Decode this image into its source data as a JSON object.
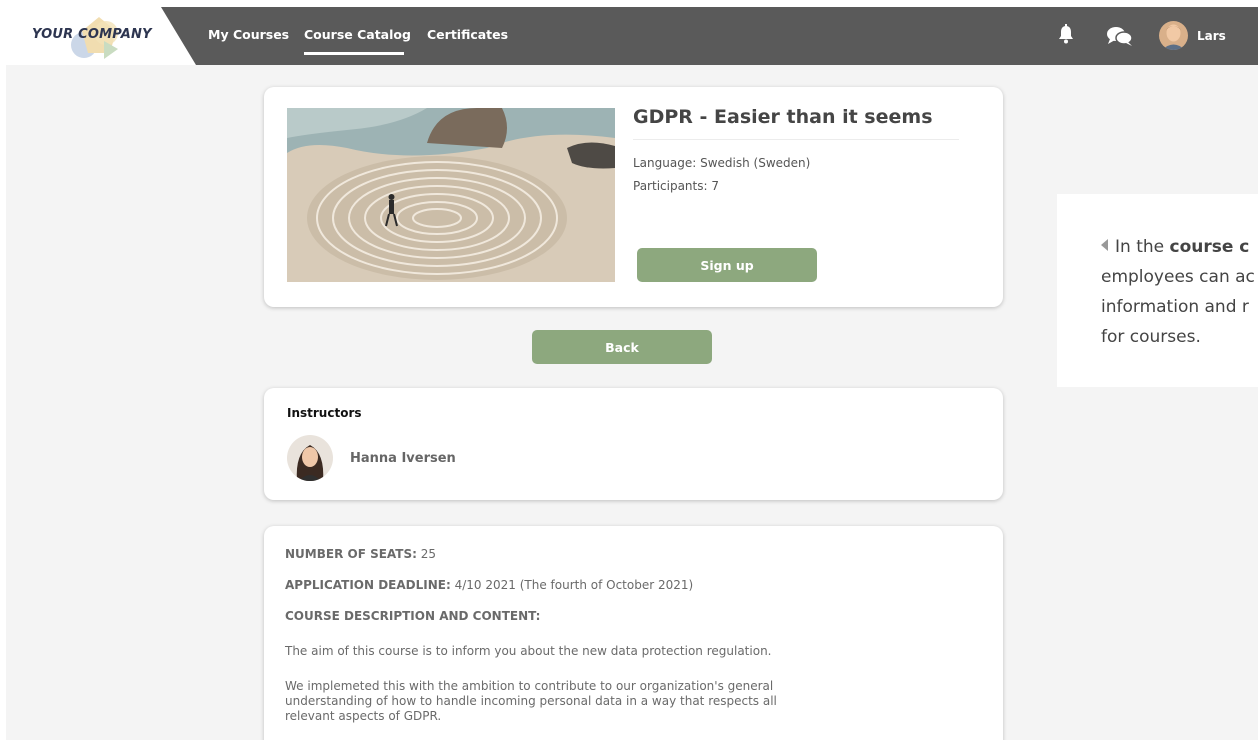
{
  "brand": {
    "logo_text": "YOUR COMPANY"
  },
  "nav": {
    "items": [
      {
        "label": "My Courses"
      },
      {
        "label": "Course Catalog"
      },
      {
        "label": "Certificates"
      }
    ],
    "user_name": "Lars",
    "icons": [
      "bell-icon",
      "chat-icon"
    ]
  },
  "course": {
    "title": "GDPR - Easier than it seems",
    "language": "Language: Swedish (Sweden)",
    "participants": "Participants: 7",
    "signup_label": "Sign up"
  },
  "back_label": "Back",
  "instructors": {
    "heading": "Instructors",
    "list": [
      {
        "name": "Hanna Iversen"
      }
    ]
  },
  "details": {
    "seats_label": "NUMBER OF SEATS:",
    "seats_value": " 25",
    "deadline_label": "APPLICATION DEADLINE:",
    "deadline_value": " 4/10 2021 (The fourth of October 2021)",
    "description_heading": "COURSE DESCRIPTION AND CONTENT:",
    "paragraph1": "The aim of this course is to inform you about the new data protection regulation.",
    "paragraph2": "We implemeted this with the ambition to contribute to our organization's general understanding of how to handle incoming personal data in a way that respects all relevant aspects of GDPR."
  },
  "side_note": {
    "prefix": "In the ",
    "bold": "course c",
    "line2": "employees can ac",
    "line3": "information and r",
    "line4": "for courses."
  },
  "colors": {
    "navbar": "#5a5a5a",
    "accent_green": "#8da87e",
    "background": "#f4f4f4"
  }
}
